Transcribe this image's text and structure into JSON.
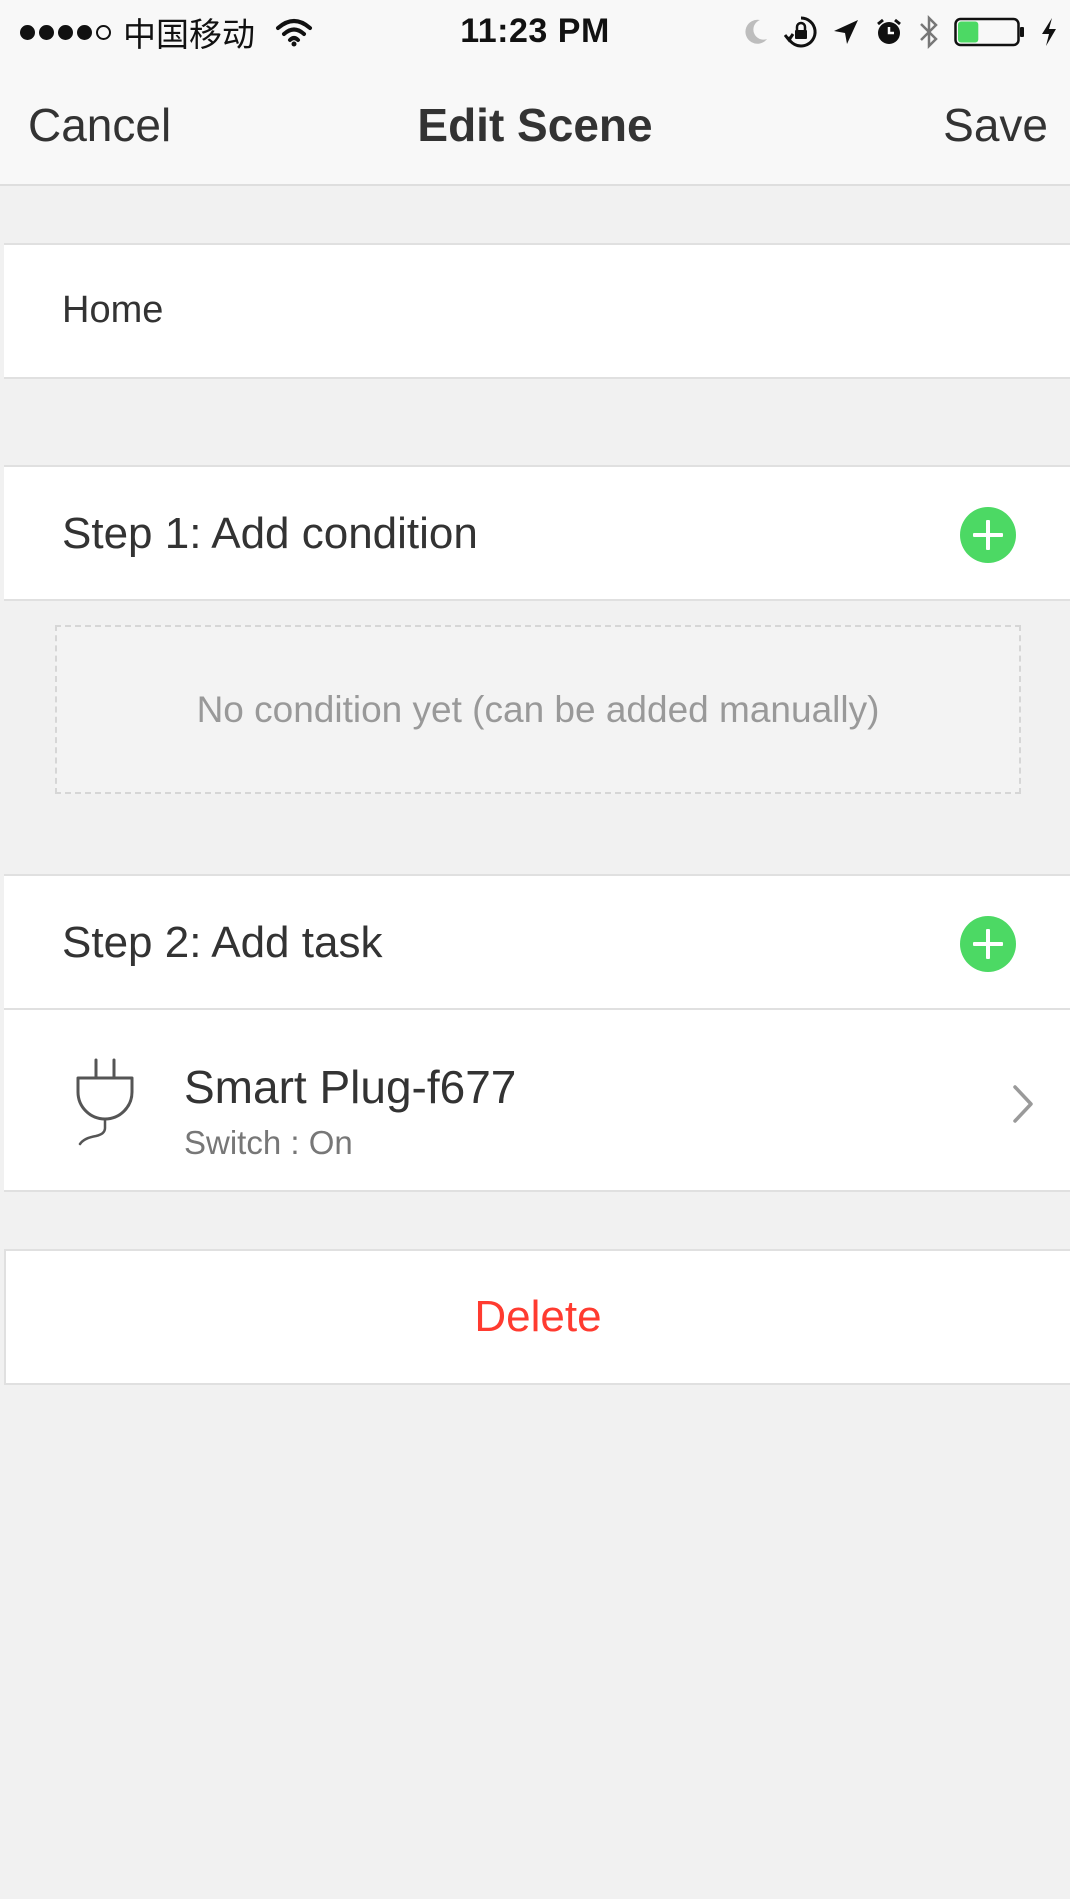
{
  "status_bar": {
    "signal_bars_filled": 4,
    "signal_bars_total": 5,
    "carrier": "中国移动",
    "time": "11:23 PM",
    "battery_level": 0.35,
    "icons": [
      "wifi-icon",
      "moon-icon",
      "rotation-lock-icon",
      "location-arrow-icon",
      "alarm-icon",
      "bluetooth-icon",
      "battery-icon",
      "charging-bolt-icon"
    ]
  },
  "nav": {
    "cancel_label": "Cancel",
    "title": "Edit Scene",
    "save_label": "Save"
  },
  "scene": {
    "name": "Home"
  },
  "step1": {
    "title": "Step 1: Add condition",
    "empty_message": "No condition yet (can be added manually)"
  },
  "step2": {
    "title": "Step 2: Add task",
    "tasks": [
      {
        "device_name": "Smart Plug-f677",
        "status": "Switch : On",
        "icon": "plug-icon"
      }
    ]
  },
  "delete_label": "Delete",
  "colors": {
    "accent_green": "#4cd964",
    "delete_red": "#ff3b30",
    "background": "#f1f1f1"
  }
}
